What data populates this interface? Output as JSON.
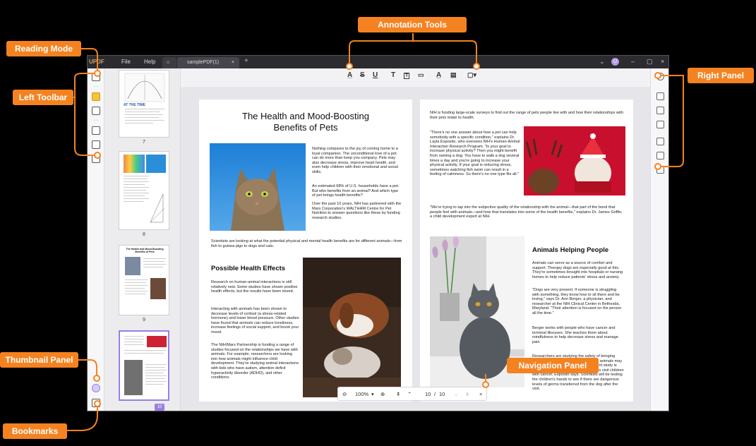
{
  "app": {
    "logo": "UPDF",
    "menu_file": "File",
    "menu_help": "Help",
    "tab_doc": "samplePDF(1)",
    "avatar": "U"
  },
  "callouts": {
    "annotation_tools": "Annotation Tools",
    "reading_mode": "Reading Mode",
    "left_toolbar": "Left Toolbar",
    "right_panel": "Right Panel",
    "thumbnail_panel": "Thumbnail Panel",
    "bookmarks": "Bookmarks",
    "navigation_panel": "Navigation Panel"
  },
  "thumbnails": [
    {
      "title": "AT THE TIME",
      "page": "7"
    },
    {
      "page": "8"
    },
    {
      "title": "The Health and Mood-Boosting Benefits of Pets",
      "page": "9"
    },
    {
      "page": "10"
    }
  ],
  "navigation": {
    "zoom": "100%",
    "page_current": "10",
    "page_sep": "/",
    "page_total": "10"
  },
  "page_left": {
    "title_line1": "The Health and Mood-Boosting",
    "title_line2": "Benefits of Pets",
    "intro_p1": "Nothing compares to the joy of coming home to a loyal companion. The unconditional love of a pet can do more than keep you company. Pets may also decrease stress, improve heart health, and even help children with their emotional and social skills.",
    "intro_p2": "An estimated 68% of U.S. households have a pet. But who benefits from an animal? And which type of pet brings health benefits?",
    "intro_p3": "Over the past 10 years, NIH has partnered with the Mars Corporation's WALTHAM Centre for Pet Nutrition to answer questions like these by funding research studies.",
    "scientists": "Scientists are looking at what the potential physical and mental health benefits are for different animals—from fish to guinea pigs to dogs and cats.",
    "h2": "Possible Health Effects",
    "effects_p1": "Research on human-animal interactions is still relatively new. Some studies have shown positive health effects, but the results have been mixed.",
    "effects_p2": "Interacting with animals has been shown to decrease levels of cortisol (a stress-related hormone) and lower blood pressure. Other studies have found that animals can reduce loneliness, increase feelings of social support, and boost your mood.",
    "effects_p3": "The NIH/Mars Partnership is funding a range of studies focused on the relationships we have with animals. For example, researchers are looking into how animals might influence child development. They're studying animal interactions with kids who have autism, attention deficit hyperactivity disorder (ADHD), and other conditions."
  },
  "page_right": {
    "top": "NIH is funding large-scale surveys to find out the range of pets people live with and how their relationships with their pets relate to health.",
    "quote1": "\"There's no one answer about how a pet can help somebody with a specific condition,\" explains Dr. Layla Esposito, who oversees NIH's Human-Animal Interaction Research Program. \"Is your goal to increase physical activity? Then you might benefit from owning a dog. You have to walk a dog several times a day and you're going to increase your physical activity. If your goal is reducing stress, sometimes watching fish swim can result in a feeling of calmness. So there's no one type fits all.\"",
    "quote2": "\"We're trying to tap into the subjective quality of the relationship with the animal—that part of the bond that people feel with animals—and how that translates into some of the health benefits,\" explains Dr. James Griffin, a child development expert at NIH.",
    "h2": "Animals Helping People",
    "help_p1": "Animals can serve as a source of comfort and support. Therapy dogs are especially good at this. They're sometimes brought into hospitals or nursing homes to help reduce patients' stress and anxiety.",
    "help_p2": "\"Dogs are very present. If someone is struggling with something, they know how to sit there and be loving,\" says Dr. Ann Berger, a physician, and researcher at the NIH Clinical Center in Bethesda, Maryland. \"Their attention is focused on the person all the time.\"",
    "help_p3": "Berger works with people who have cancer and terminal illnesses. She teaches them about mindfulness to help decrease stress and manage pain",
    "help_p4": "Researchers are studying the safety of bringing animals into hospital settings because animals may expose people to more germs. A current study is looking at the safety of bringing dogs to visit children with cancer, Esposito says. Scientists will be testing the children's hands to see if there are dangerous levels of germs transferred from the dog after the visit."
  }
}
